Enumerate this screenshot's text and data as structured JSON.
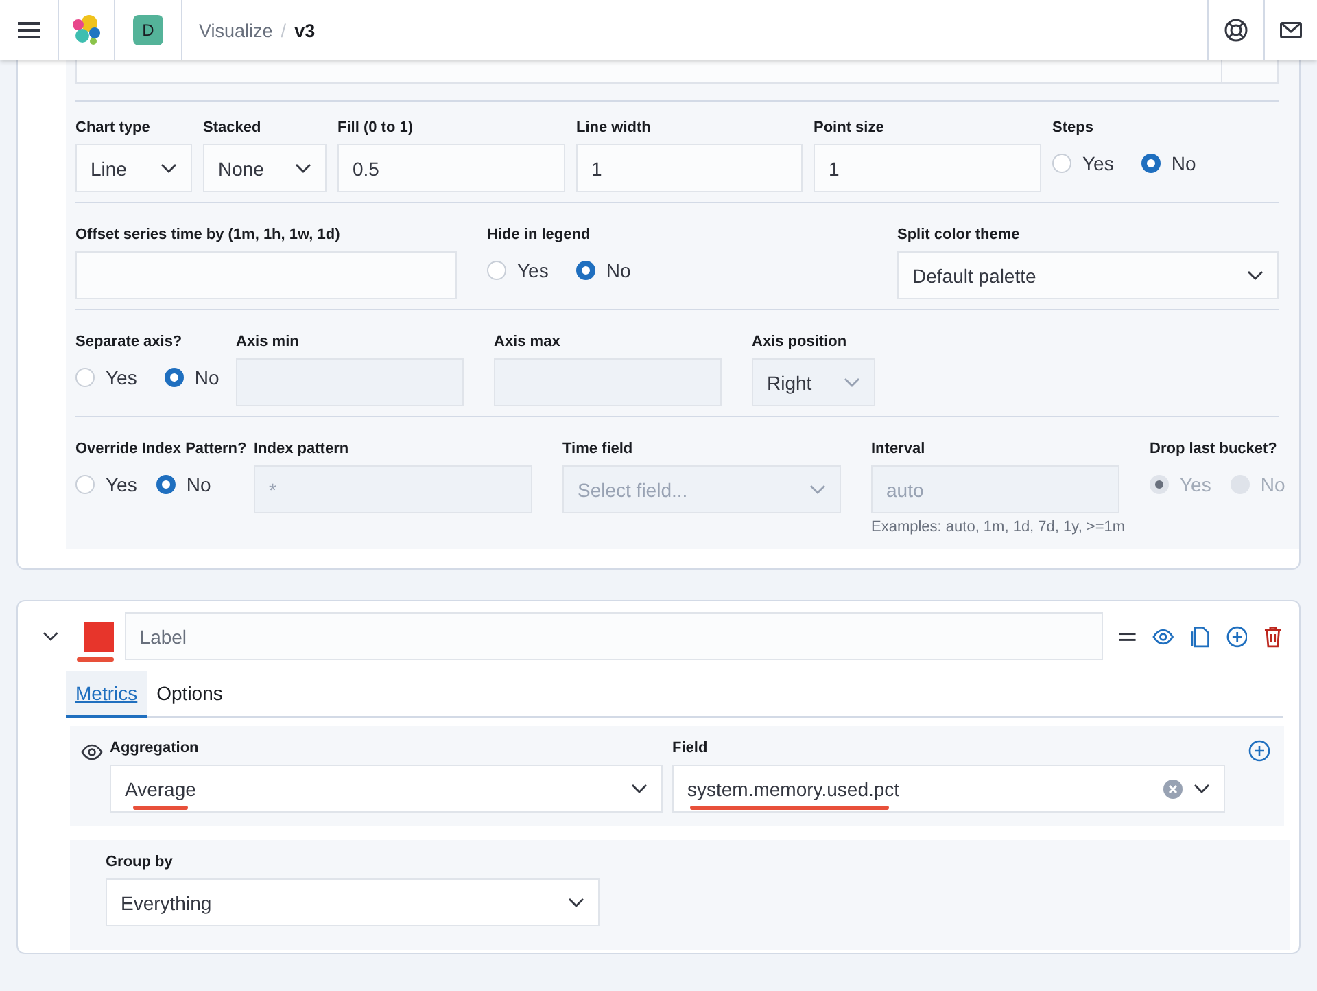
{
  "header": {
    "avatar": "D",
    "breadcrumbs": [
      {
        "text": "Visualize",
        "current": false
      },
      {
        "separator": "/",
        "text": "v3",
        "current": true
      }
    ]
  },
  "option_rows": [
    [
      {
        "kind": "select",
        "label": "Chart type",
        "value": "Line",
        "disabled": false
      },
      {
        "kind": "select",
        "label": "Stacked",
        "value": "None",
        "disabled": false
      },
      {
        "kind": "input",
        "label": "Fill (0 to 1)",
        "value": "0.5",
        "disabled": false
      },
      {
        "kind": "input",
        "label": "Line width",
        "value": "1",
        "disabled": false
      },
      {
        "kind": "input",
        "label": "Point size",
        "value": "1",
        "disabled": false
      },
      {
        "kind": "radio",
        "label": "Steps",
        "disabled": false,
        "options": [
          {
            "label": "Yes",
            "selected": false
          },
          {
            "label": "No",
            "selected": true
          }
        ]
      }
    ],
    [
      {
        "kind": "input",
        "label": "Offset series time by (1m, 1h, 1w, 1d)",
        "disabled": false
      },
      {
        "kind": "radio",
        "label": "Hide in legend",
        "disabled": false,
        "options": [
          {
            "label": "Yes",
            "selected": false
          },
          {
            "label": "No",
            "selected": true
          }
        ]
      },
      {
        "kind": "select",
        "label": "Split color theme",
        "value": "Default palette",
        "disabled": false
      }
    ],
    [
      {
        "kind": "radio",
        "label": "Separate axis?",
        "disabled": false,
        "options": [
          {
            "label": "Yes",
            "selected": false
          },
          {
            "label": "No",
            "selected": true
          }
        ]
      },
      {
        "kind": "input",
        "label": "Axis min",
        "disabled": true
      },
      {
        "kind": "input",
        "label": "Axis max",
        "disabled": true
      },
      {
        "kind": "select",
        "label": "Axis position",
        "value": "Right",
        "disabled": true
      }
    ],
    [
      {
        "kind": "radio",
        "label": "Override Index Pattern?",
        "disabled": false,
        "options": [
          {
            "label": "Yes",
            "selected": false
          },
          {
            "label": "No",
            "selected": true
          }
        ]
      },
      {
        "kind": "input",
        "label": "Index pattern",
        "placeholder": "*",
        "disabled": true
      },
      {
        "kind": "select",
        "label": "Time field",
        "placeholder": "Select field...",
        "disabled": true
      },
      {
        "kind": "input",
        "label": "Interval",
        "placeholder": "auto",
        "disabled": true,
        "help": "Examples: auto, 1m, 1d, 7d, 1y, >=1m"
      },
      {
        "kind": "radio",
        "label": "Drop last bucket?",
        "disabled": true,
        "options": [
          {
            "label": "Yes",
            "selected": true
          },
          {
            "label": "No",
            "selected": false
          }
        ]
      }
    ]
  ],
  "series": {
    "expanded": true,
    "color": "#e7352b",
    "color_annotated": true,
    "label_placeholder": "Label",
    "tabs": [
      {
        "label": "Metrics",
        "selected": true
      },
      {
        "label": "Options",
        "selected": false
      }
    ],
    "metric": {
      "aggregation_label": "Aggregation",
      "aggregation": "Average",
      "aggregation_annotated": true,
      "field_label": "Field",
      "field": "system.memory.used.pct",
      "field_annotated": true,
      "clearable": true
    },
    "group_by": {
      "label": "Group by",
      "value": "Everything"
    }
  }
}
